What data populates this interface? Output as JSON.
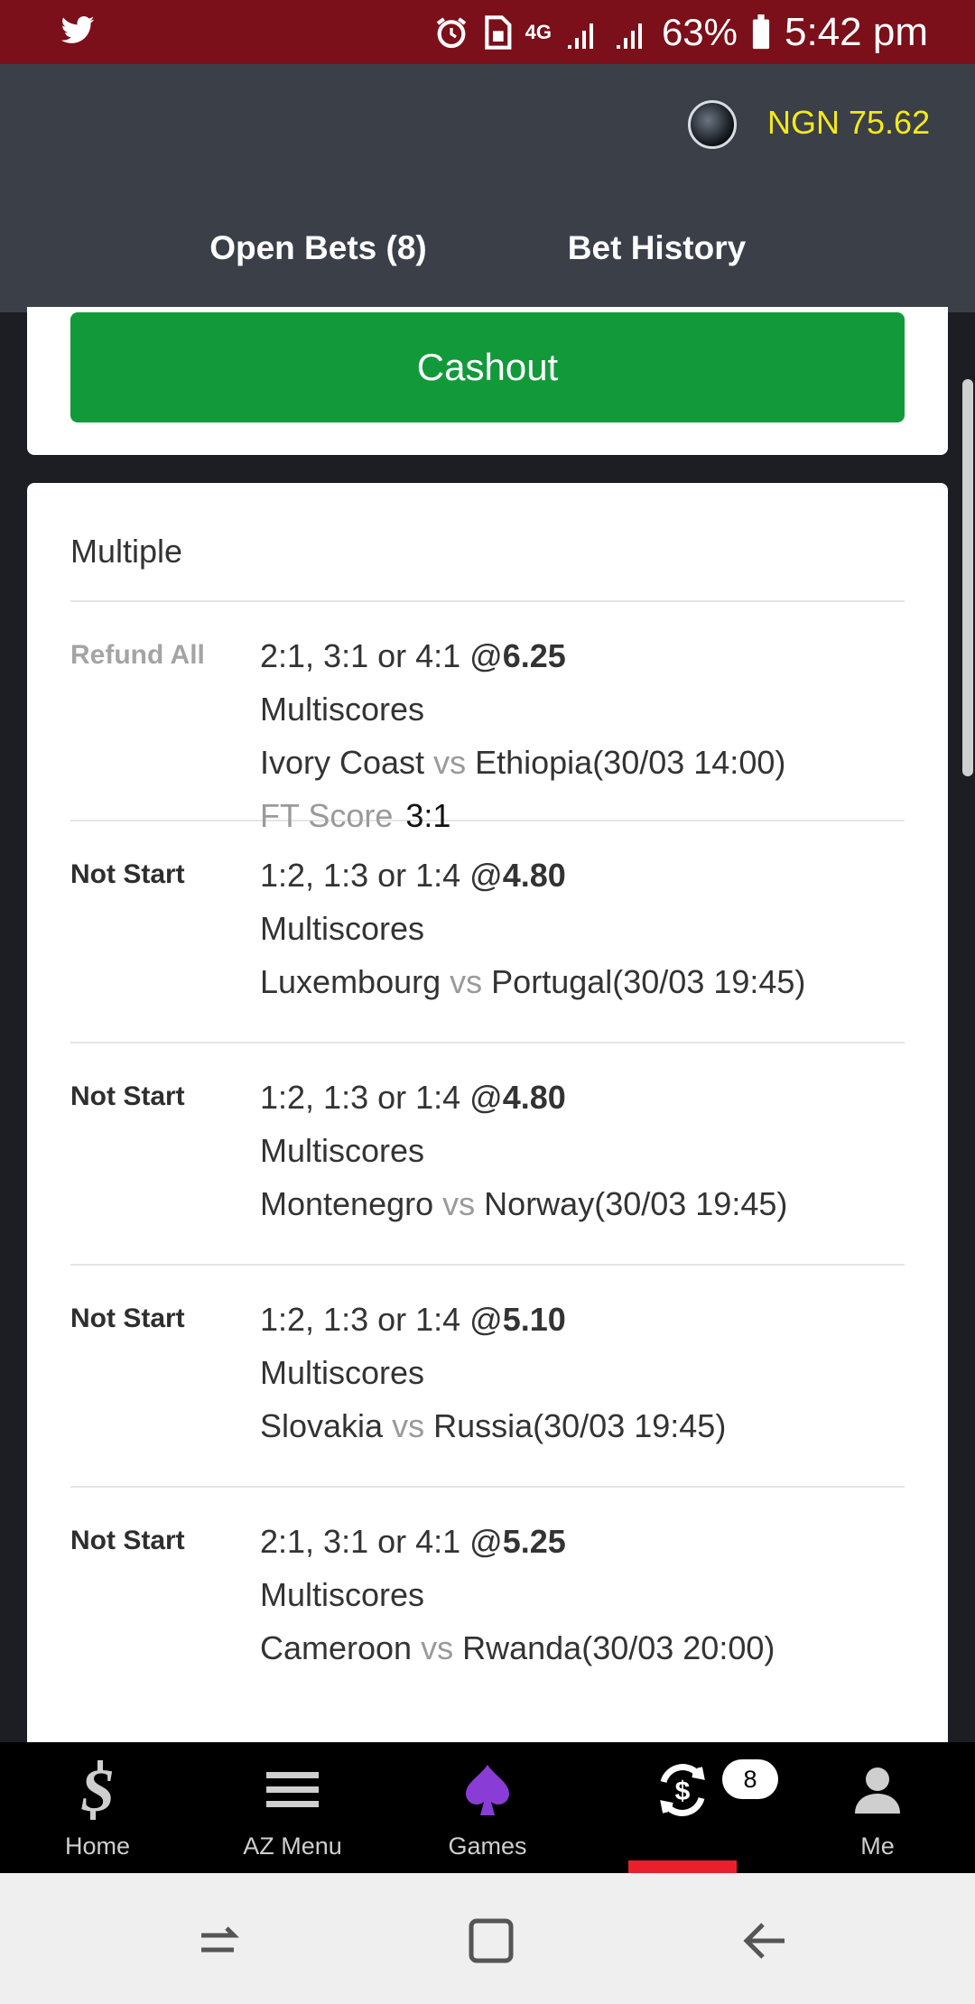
{
  "status_bar": {
    "network": "4G",
    "battery": "63%",
    "time": "5:42 pm"
  },
  "header": {
    "balance": "NGN 75.62",
    "tabs": [
      {
        "label": "Open Bets (8)",
        "active": true
      },
      {
        "label": "Bet History",
        "active": false
      }
    ]
  },
  "cashout": {
    "label": "Cashout"
  },
  "multiple": {
    "title": "Multiple",
    "bets": [
      {
        "status": "Refund All",
        "selection": "2:1, 3:1 or 4:1 @",
        "odds": "6.25",
        "market": "Multiscores",
        "home": "Ivory Coast",
        "vs": "vs",
        "away": "Ethiopia(30/03 14:00)",
        "ft_label": "FT Score",
        "ft_score": "3:1"
      },
      {
        "status": "Not Start",
        "selection": "1:2, 1:3 or 1:4 @",
        "odds": "4.80",
        "market": "Multiscores",
        "home": "Luxembourg",
        "vs": "vs",
        "away": "Portugal(30/03 19:45)"
      },
      {
        "status": "Not Start",
        "selection": "1:2, 1:3 or 1:4 @",
        "odds": "4.80",
        "market": "Multiscores",
        "home": "Montenegro",
        "vs": "vs",
        "away": "Norway(30/03 19:45)"
      },
      {
        "status": "Not Start",
        "selection": "1:2, 1:3 or 1:4 @",
        "odds": "5.10",
        "market": "Multiscores",
        "home": "Slovakia",
        "vs": "vs",
        "away": "Russia(30/03 19:45)"
      },
      {
        "status": "Not Start",
        "selection": "2:1, 3:1 or 4:1 @",
        "odds": "5.25",
        "market": "Multiscores",
        "home": "Cameroon",
        "vs": "vs",
        "away": "Rwanda(30/03 20:00)"
      }
    ]
  },
  "bottom_nav": {
    "items": [
      {
        "label": "Home",
        "icon": "dollar-s-icon"
      },
      {
        "label": "AZ Menu",
        "icon": "menu-icon"
      },
      {
        "label": "Games",
        "icon": "spade-icon"
      },
      {
        "label": "",
        "icon": "cashout-cycle-icon",
        "active": true
      },
      {
        "label": "Me",
        "icon": "person-icon"
      }
    ],
    "badge": "8",
    "active_color": "#e8202c"
  },
  "colors": {
    "status_bar": "#7b0f1a",
    "header": "#3b3f48",
    "balance": "#f4ea17",
    "cashout": "#129a3a",
    "tab_indicator": "#20b35a"
  }
}
